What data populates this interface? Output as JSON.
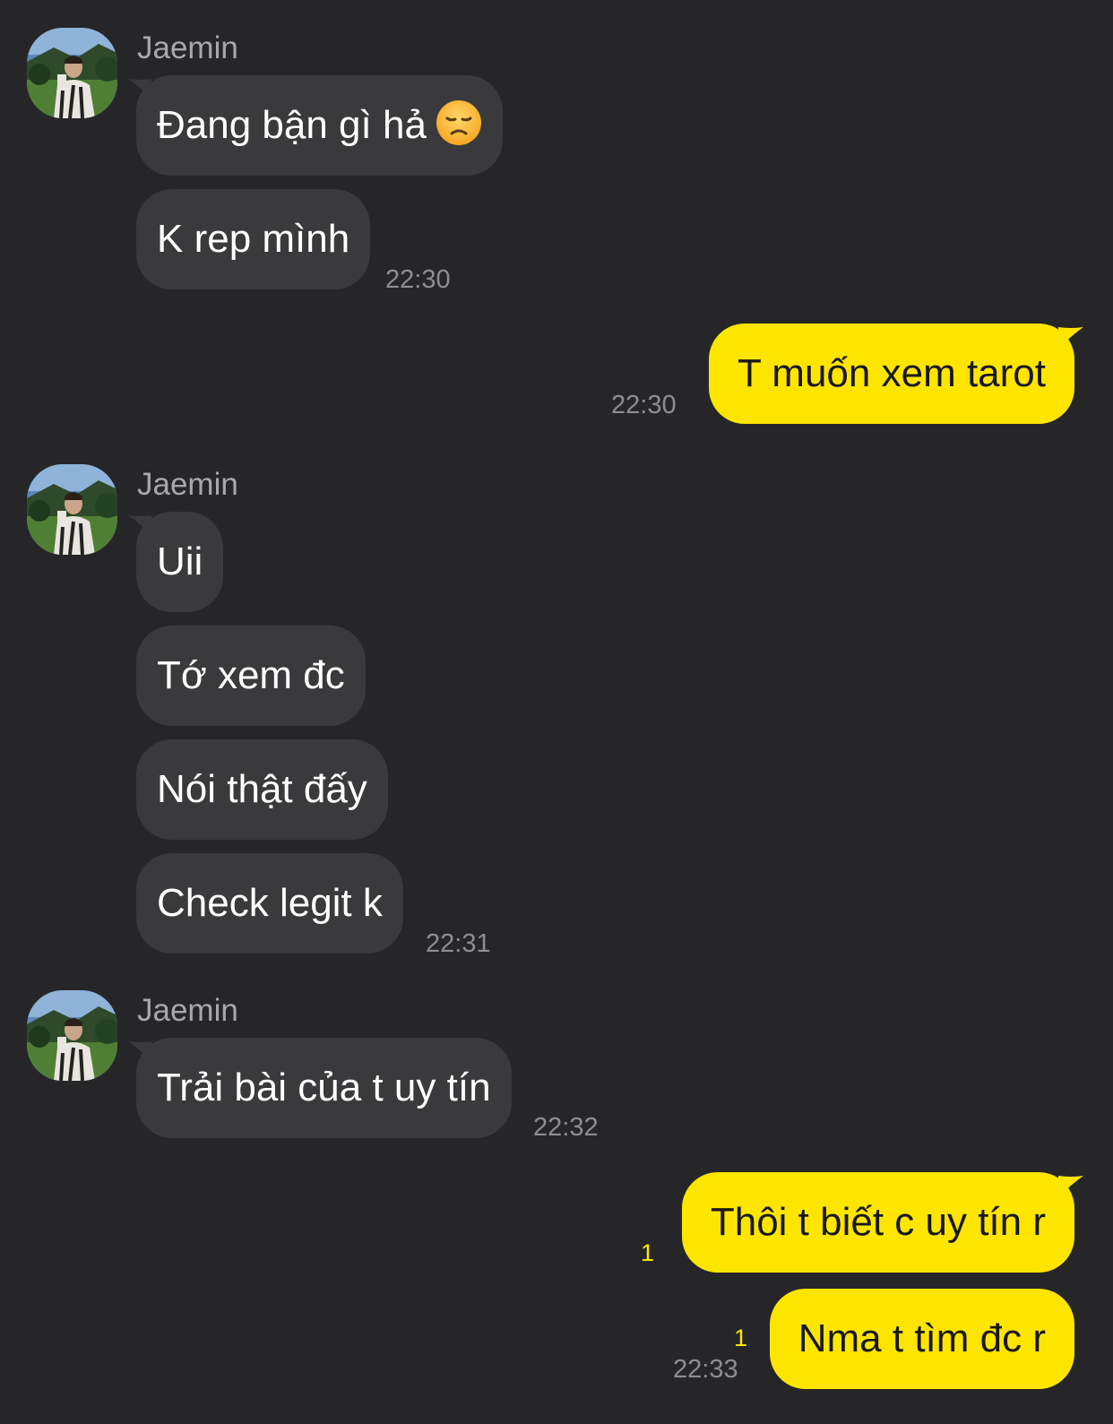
{
  "colors": {
    "background": "#262628",
    "incoming_bubble": "#3a3a3c",
    "outgoing_bubble": "#fee500",
    "unread_badge": "#fee500"
  },
  "messages": {
    "group1": {
      "sender": "Jaemin",
      "msg1": "Đang bận gì hả",
      "msg1_emoji": "disappointed-face-emoji",
      "msg2": "K rep mình",
      "time": "22:30"
    },
    "out1": {
      "msg": "T muốn xem tarot",
      "time": "22:30"
    },
    "group2": {
      "sender": "Jaemin",
      "msg1": "Uii",
      "msg2": "Tớ xem đc",
      "msg3": "Nói thật đấy",
      "msg4": "Check legit k",
      "time": "22:31"
    },
    "group3": {
      "sender": "Jaemin",
      "msg1": "Trải bài của t uy tín",
      "time": "22:32"
    },
    "out2": {
      "msg1": "Thôi t biết c uy tín r",
      "msg1_unread": "1",
      "msg2": "Nma t tìm đc r",
      "msg2_unread": "1",
      "time": "22:33"
    }
  }
}
